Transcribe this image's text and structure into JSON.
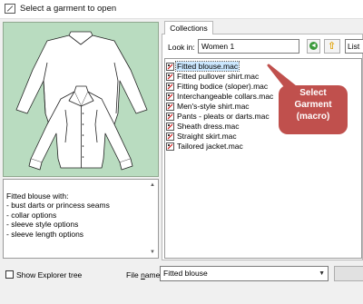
{
  "window": {
    "title": "Select a garment to open"
  },
  "description": {
    "text": "Fitted blouse with:\n- bust darts or princess seams\n- collar options\n- sleeve style options\n- sleeve length options"
  },
  "tabs": [
    {
      "label": "Collections",
      "active": true
    }
  ],
  "lookin": {
    "label": "Look in:",
    "value": "Women 1"
  },
  "view": {
    "value": "List"
  },
  "files": [
    {
      "name": "Fitted blouse.mac",
      "selected": true
    },
    {
      "name": "Fitted pullover shirt.mac"
    },
    {
      "name": "Fitting bodice (sloper).mac"
    },
    {
      "name": "Interchangeable collars.mac"
    },
    {
      "name": "Men's-style shirt.mac"
    },
    {
      "name": "Pants - pleats or darts.mac"
    },
    {
      "name": "Sheath dress.mac"
    },
    {
      "name": "Straight skirt.mac"
    },
    {
      "name": "Tailored jacket.mac"
    }
  ],
  "annotation": {
    "lines": [
      "Select",
      "Garment",
      "(macro)"
    ],
    "color": "#c0504d"
  },
  "bottom": {
    "explorer_label": "Show Explorer tree",
    "filename_label_pre": "File ",
    "filename_label_accel": "n",
    "filename_label_post": "ame:",
    "filename_value": "Fitted blouse"
  },
  "colors": {
    "preview_bg": "#b9dcc0",
    "selection": "#cce8ff"
  }
}
